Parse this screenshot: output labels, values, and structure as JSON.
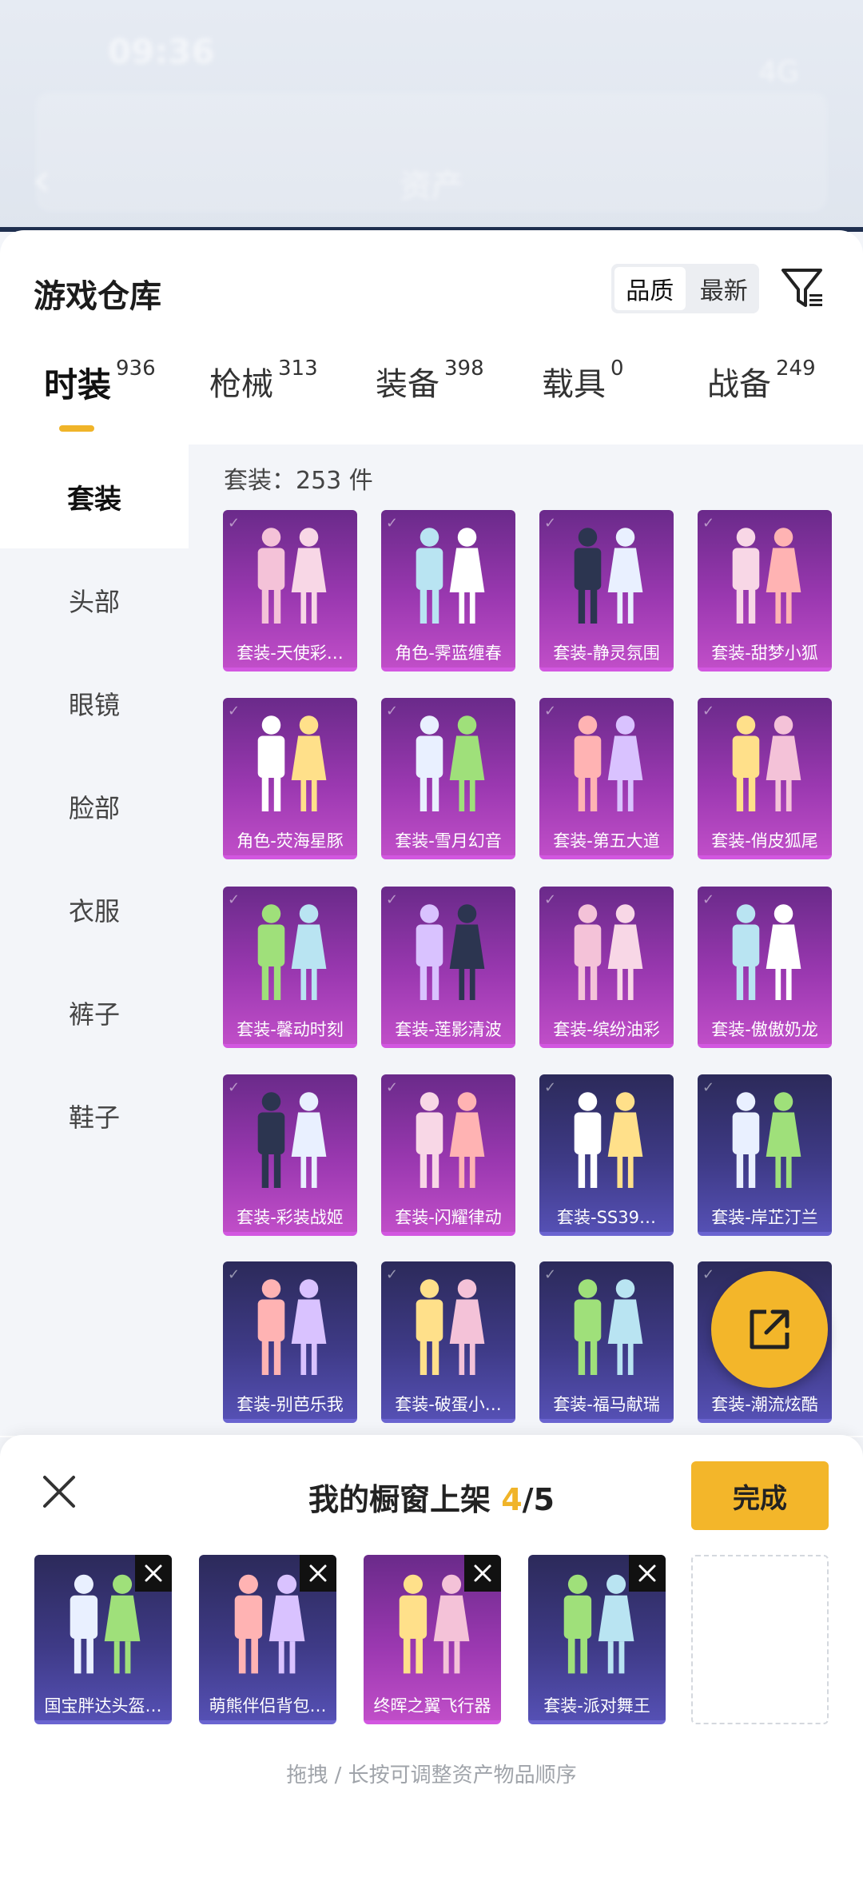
{
  "status_bar": {
    "time": "09:36",
    "network": "4G"
  },
  "bg_header": {
    "title": "资产"
  },
  "sheet": {
    "title": "游戏仓库",
    "sort": {
      "quality": "品质",
      "newest": "最新"
    },
    "tabs": [
      {
        "label": "时装",
        "count": "936"
      },
      {
        "label": "枪械",
        "count": "313"
      },
      {
        "label": "装备",
        "count": "398"
      },
      {
        "label": "载具",
        "count": "0"
      },
      {
        "label": "战备",
        "count": "249"
      }
    ],
    "side": [
      "套装",
      "头部",
      "眼镜",
      "脸部",
      "衣服",
      "裤子",
      "鞋子"
    ],
    "count_line": "套装：253 件",
    "items": [
      {
        "name": "套装-天使彩…",
        "tone": "purple"
      },
      {
        "name": "角色-霁蓝缠春",
        "tone": "purple"
      },
      {
        "name": "套装-静灵氛围",
        "tone": "purple"
      },
      {
        "name": "套装-甜梦小狐",
        "tone": "purple"
      },
      {
        "name": "角色-荧海星豚",
        "tone": "purple"
      },
      {
        "name": "套装-雪月幻音",
        "tone": "purple"
      },
      {
        "name": "套装-第五大道",
        "tone": "purple"
      },
      {
        "name": "套装-俏皮狐尾",
        "tone": "purple"
      },
      {
        "name": "套装-馨动时刻",
        "tone": "purple"
      },
      {
        "name": "套装-莲影清波",
        "tone": "purple"
      },
      {
        "name": "套装-缤纷油彩",
        "tone": "purple"
      },
      {
        "name": "套装-傲傲奶龙",
        "tone": "purple"
      },
      {
        "name": "套装-彩装战姬",
        "tone": "purple"
      },
      {
        "name": "套装-闪耀律动",
        "tone": "purple"
      },
      {
        "name": "套装-SS39…",
        "tone": "blue"
      },
      {
        "name": "套装-岸芷汀兰",
        "tone": "blue"
      },
      {
        "name": "套装-别芭乐我",
        "tone": "blue"
      },
      {
        "name": "套装-破蛋小…",
        "tone": "blue"
      },
      {
        "name": "套装-福马献瑞",
        "tone": "blue"
      },
      {
        "name": "套装-潮流炫酷",
        "tone": "blue"
      }
    ]
  },
  "shelf": {
    "title_prefix": "我的橱窗上架 ",
    "current": "4",
    "total": "/5",
    "done": "完成",
    "slots": [
      {
        "name": "国宝胖达头盔…",
        "tone": "blue"
      },
      {
        "name": "萌熊伴侣背包…",
        "tone": "blue"
      },
      {
        "name": "终晖之翼飞行器",
        "tone": "purple"
      },
      {
        "name": "套装-派对舞王",
        "tone": "blue"
      }
    ],
    "hint": "拖拽 / 长按可调整资产物品顺序"
  },
  "colors": {
    "accent": "#f3b62a",
    "purple_card": "#9a38b0",
    "blue_card": "#3e3a86"
  }
}
